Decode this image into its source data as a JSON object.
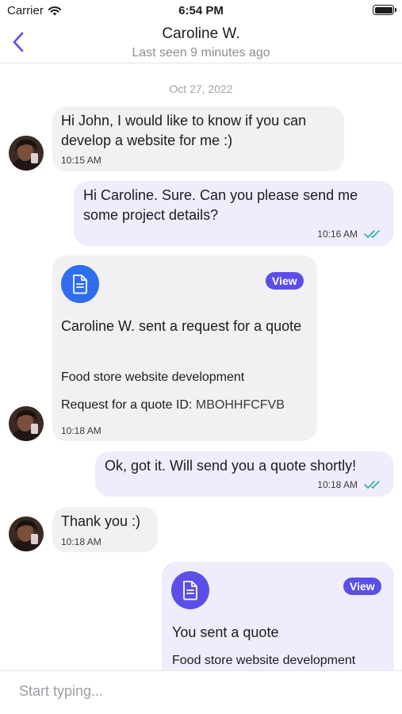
{
  "status_bar": {
    "carrier": "Carrier",
    "time": "6:54 PM"
  },
  "header": {
    "contact_name": "Caroline W.",
    "last_seen": "Last seen 9 minutes ago"
  },
  "date_separator": "Oct 27, 2022",
  "messages": [
    {
      "text": "Hi John, I would like to know if you can develop a website for me :)",
      "time": "10:15 AM"
    },
    {
      "text": "Hi Caroline. Sure. Can you please send me some project details?",
      "time": "10:16 AM"
    },
    {
      "title": "Caroline W. sent a request for a quote",
      "subtitle": "Food store website development",
      "id_label": "Request for a quote ID:",
      "id_value": "MBOHHFCFVB",
      "view_label": "View",
      "time": "10:18 AM"
    },
    {
      "text": "Ok, got it. Will send you a quote shortly!",
      "time": "10:18 AM"
    },
    {
      "text": "Thank you :)",
      "time": "10:18 AM"
    },
    {
      "title": "You sent a quote",
      "subtitle": "Food store website development",
      "view_label": "View"
    }
  ],
  "composer": {
    "placeholder": "Start typing..."
  },
  "colors": {
    "accent": "#5b4fe9",
    "incoming_bubble": "#f1f1f3",
    "outgoing_bubble": "#efedfc",
    "read_ticks": "#2bb0a6",
    "request_icon": "#2f6cf0"
  },
  "icons": {
    "back": "chevron-left-icon",
    "document": "document-icon",
    "read_receipt": "double-check-icon"
  }
}
